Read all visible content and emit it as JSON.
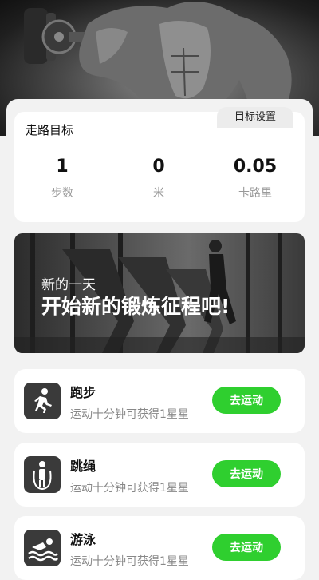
{
  "goal": {
    "title": "走路目标",
    "settings_tab": "目标设置",
    "stats": [
      {
        "value": "1",
        "label": "步数"
      },
      {
        "value": "0",
        "label": "米"
      },
      {
        "value": "0.05",
        "label": "卡路里"
      }
    ]
  },
  "banner": {
    "line1": "新的一天",
    "line2": "开始新的锻炼征程吧!"
  },
  "activities": [
    {
      "name": "跑步",
      "desc": "运动十分钟可获得1星星",
      "button": "去运动",
      "icon": "running-icon"
    },
    {
      "name": "跳绳",
      "desc": "运动十分钟可获得1星星",
      "button": "去运动",
      "icon": "jump-rope-icon"
    },
    {
      "name": "游泳",
      "desc": "运动十分钟可获得1星星",
      "button": "去运动",
      "icon": "swimming-icon"
    }
  ],
  "colors": {
    "accent": "#2fcf2f",
    "icon_bg": "#3a3a3a"
  }
}
